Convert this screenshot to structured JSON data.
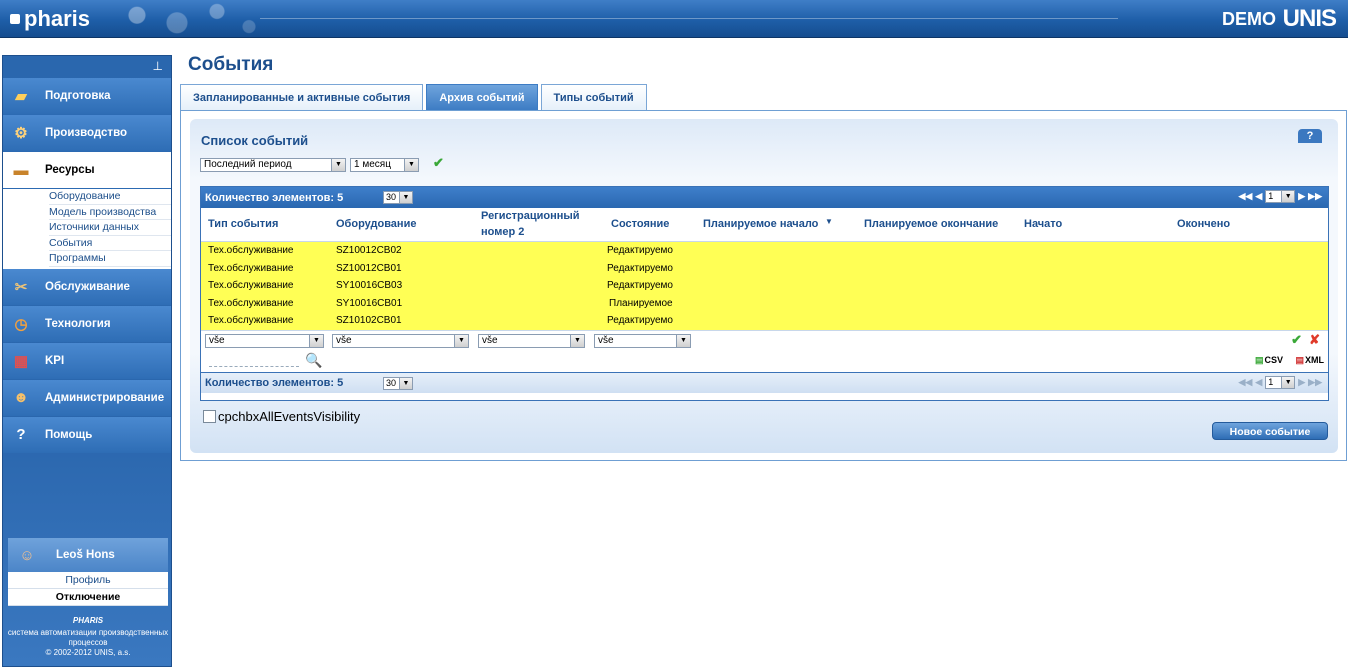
{
  "header": {
    "logo": "pharis",
    "demo": "DEMO",
    "vendor_logo": "UNIS"
  },
  "sidebar": {
    "pin_icon": "pin-icon",
    "items": [
      {
        "label": "Подготовка",
        "icon": "book-icon"
      },
      {
        "label": "Производство",
        "icon": "satellite-icon"
      },
      {
        "label": "Ресурсы",
        "icon": "truck-icon"
      },
      {
        "label": "Обслуживание",
        "icon": "tools-icon"
      },
      {
        "label": "Технология",
        "icon": "clock-icon"
      },
      {
        "label": "KPI",
        "icon": "chart-icon"
      },
      {
        "label": "Администрирование",
        "icon": "users-icon"
      },
      {
        "label": "Помощь",
        "icon": "help-icon"
      }
    ],
    "resources_sub": [
      "Оборудование",
      "Модель производства",
      "Источники данных",
      "События",
      "Программы"
    ]
  },
  "user": {
    "name": "Leoš Hons",
    "profile": "Профиль",
    "logout": "Отключение"
  },
  "footer": {
    "brand": "PHARIS",
    "line1": "система автоматизации производственных",
    "line2": "процессов",
    "copyright": "© 2002-2012 UNIS, a.s."
  },
  "page": {
    "title": "События"
  },
  "tabs": [
    "Запланированные и активные события",
    "Архив событий",
    "Типы событий"
  ],
  "list": {
    "title": "Список событий",
    "period": "Последний период",
    "duration": "1 месяц",
    "count_label": "Количество элементов: 5",
    "page_size": "30",
    "page": "1",
    "help": "?",
    "columns": [
      "Тип события",
      "Оборудование",
      "Регистрационный",
      "номер 2",
      "Состояние",
      "Планируемое начало",
      "Планируемое окончание",
      "Начато",
      "Окончено"
    ],
    "sort_indicator": "▼",
    "rows": [
      {
        "type": "Тех.обслуживание",
        "equipment": "SZ10012CB02",
        "state": "Редактируемо"
      },
      {
        "type": "Тех.обслуживание",
        "equipment": "SZ10012CB01",
        "state": "Редактируемо"
      },
      {
        "type": "Тех.обслуживание",
        "equipment": "SY10016CB03",
        "state": "Редактируемо"
      },
      {
        "type": "Тех.обслуживание",
        "equipment": "SY10016CB01",
        "state": "Планируемое"
      },
      {
        "type": "Тех.обслуживание",
        "equipment": "SZ10102CB01",
        "state": "Редактируемо"
      }
    ],
    "filters": [
      "vše",
      "vše",
      "vše",
      "vše"
    ],
    "csv": "CSV",
    "xml": "XML",
    "checkbox_label": "cpchbxAllEventsVisibility",
    "new_button": "Новое событие"
  }
}
